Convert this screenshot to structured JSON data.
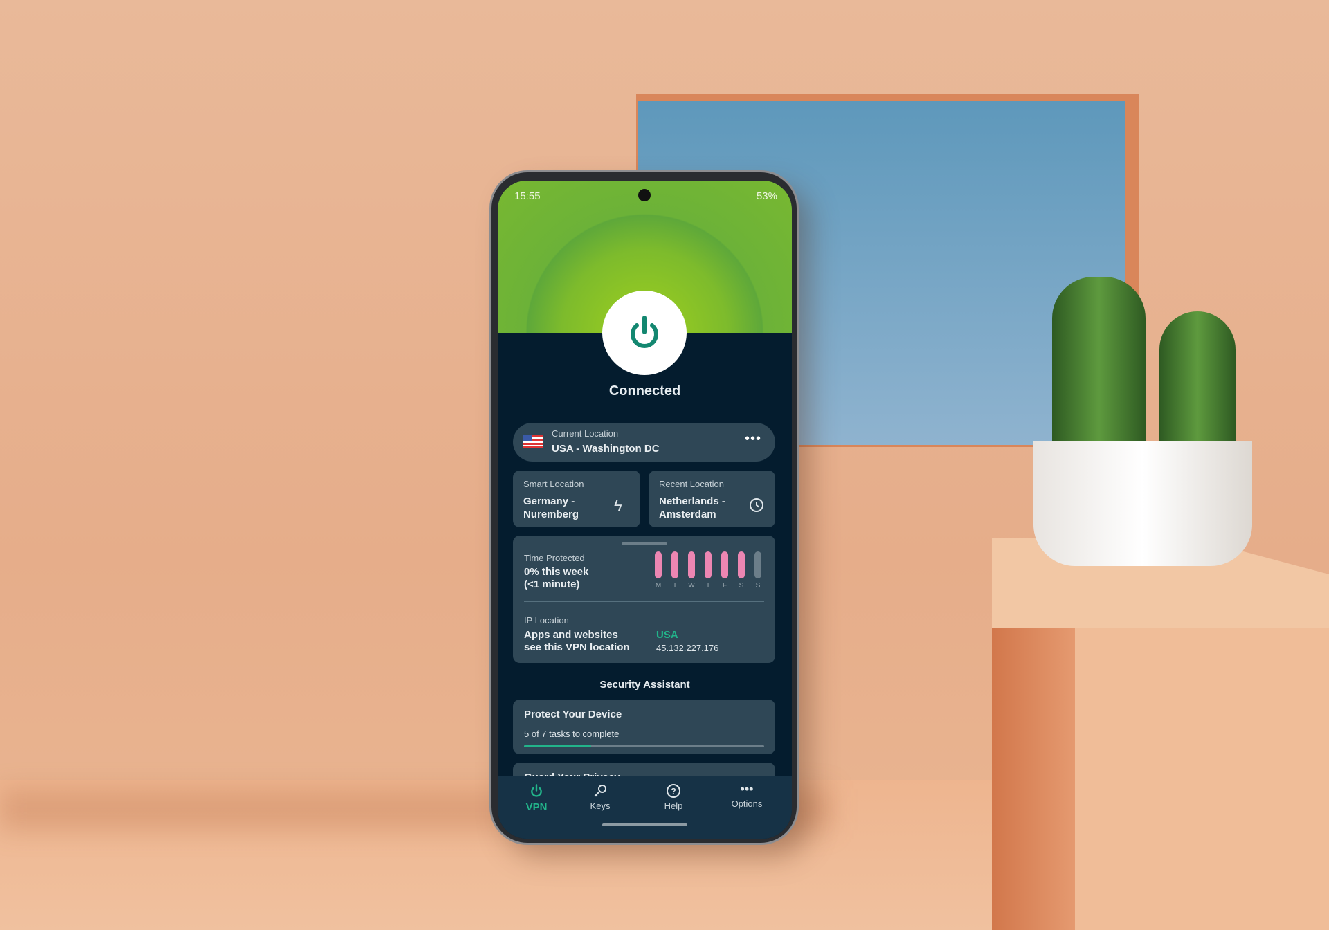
{
  "status_bar": {
    "time": "15:55",
    "battery": "53%"
  },
  "hero": {
    "status": "Connected",
    "power_icon": "power-icon"
  },
  "current_location": {
    "label": "Current Location",
    "value": "USA - Washington DC",
    "flag": "us-flag-icon",
    "more_icon": "more-icon"
  },
  "smart_location": {
    "label": "Smart Location",
    "line1": "Germany -",
    "line2": "Nuremberg",
    "icon": "lightning-icon"
  },
  "recent_location": {
    "label": "Recent Location",
    "line1": "Netherlands -",
    "line2": "Amsterdam",
    "icon": "clock-icon"
  },
  "time_protected": {
    "label": "Time Protected",
    "line1": "0% this week",
    "line2": "(<1 minute)",
    "days": [
      "M",
      "T",
      "W",
      "T",
      "F",
      "S",
      "S"
    ],
    "active": [
      true,
      true,
      true,
      true,
      true,
      true,
      false
    ]
  },
  "ip_location": {
    "label": "IP Location",
    "line1": "Apps and websites",
    "line2": "see this VPN location",
    "country": "USA",
    "ip": "45.132.227.176"
  },
  "security": {
    "heading": "Security Assistant",
    "card_title": "Protect Your Device",
    "card_sub": "5 of 7 tasks to complete",
    "progress": 0.28,
    "next_card": "Guard Your Privacy"
  },
  "nav": [
    {
      "label": "VPN",
      "icon": "power-icon",
      "active": true
    },
    {
      "label": "Keys",
      "icon": "key-icon"
    },
    {
      "label": "Help",
      "icon": "help-icon"
    },
    {
      "label": "Options",
      "icon": "more-icon"
    }
  ],
  "colors": {
    "accent": "#22b48a",
    "hero_green": "#7dbb2c",
    "background": "#041c2e",
    "card": "#2f4756",
    "bar_active": "#ec86b2"
  }
}
